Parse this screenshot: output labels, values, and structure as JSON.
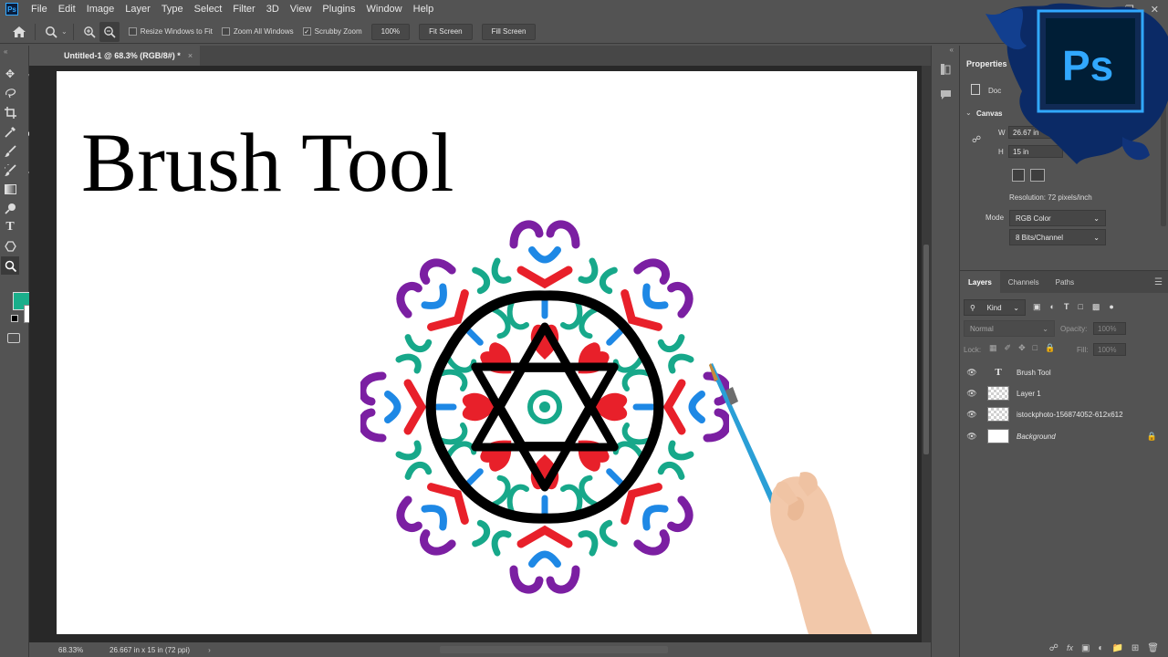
{
  "menubar": {
    "app_badge": "Ps",
    "items": [
      "File",
      "Edit",
      "Image",
      "Layer",
      "Type",
      "Select",
      "Filter",
      "3D",
      "View",
      "Plugins",
      "Window",
      "Help"
    ]
  },
  "options": {
    "resize_windows": "Resize Windows to Fit",
    "zoom_all": "Zoom All Windows",
    "scrubby_zoom": "Scrubby Zoom",
    "zoom_value": "100%",
    "fit_screen": "Fit Screen",
    "fill_screen": "Fill Screen"
  },
  "document": {
    "tab_label": "Untitled-1 @ 68.3% (RGB/8#) *",
    "canvas_text": "Brush Tool"
  },
  "status": {
    "zoom": "68.33%",
    "doc_size": "26.667 in x 15 in (72 ppi)"
  },
  "properties": {
    "tab": "Properties",
    "doc_label": "Doc",
    "canvas_section": "Canvas",
    "w_label": "W",
    "w_value": "26.67 in",
    "h_label": "H",
    "h_value": "15 in",
    "resolution": "Resolution: 72 pixels/inch",
    "mode_label": "Mode",
    "mode_value": "RGB Color",
    "depth_value": "8 Bits/Channel"
  },
  "layers": {
    "tabs": [
      "Layers",
      "Channels",
      "Paths"
    ],
    "filter": "Kind",
    "blend_mode": "Normal",
    "opacity_label": "Opacity:",
    "opacity_value": "100%",
    "lock_label": "Lock:",
    "fill_label": "Fill:",
    "fill_value": "100%",
    "rows": [
      {
        "name": "Brush Tool"
      },
      {
        "name": "Layer 1"
      },
      {
        "name": "istockphoto-156874052-612x612"
      },
      {
        "name": "Background"
      }
    ]
  },
  "logo": {
    "text": "Ps"
  },
  "colors": {
    "foreground": "#1aaf8b",
    "background": "#ffffff",
    "mandala_purple": "#7b1fa2",
    "mandala_teal": "#17a88a",
    "mandala_red": "#e8202a",
    "mandala_blue": "#1e88e5",
    "mandala_black": "#000000"
  }
}
